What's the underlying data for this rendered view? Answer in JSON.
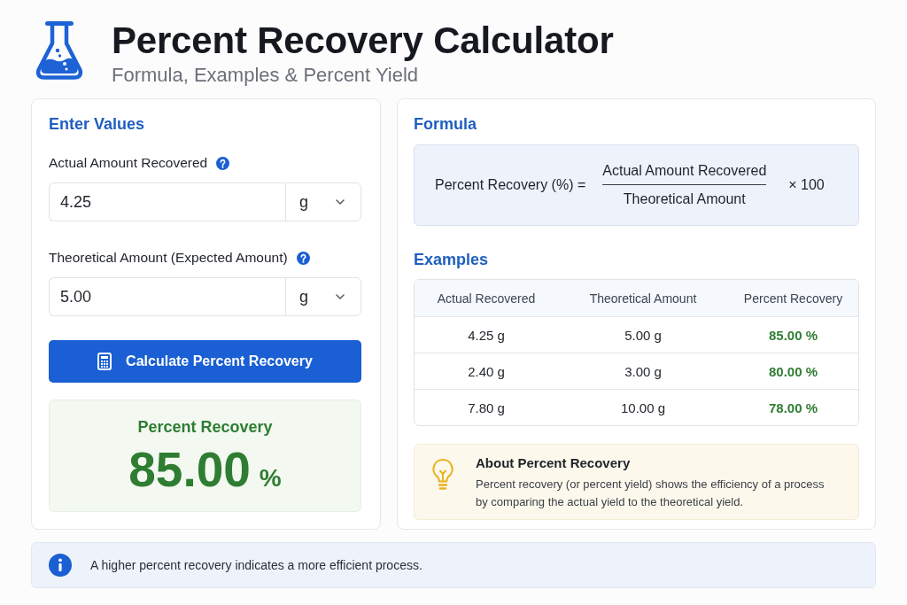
{
  "header": {
    "title": "Percent Recovery Calculator",
    "subtitle": "Formula, Examples & Percent Yield"
  },
  "input_panel": {
    "heading": "Enter Values",
    "fields": [
      {
        "label": "Actual Amount Recovered",
        "value": "4.25",
        "unit": "g"
      },
      {
        "label": "Theoretical Amount (Expected Amount)",
        "value": "5.00",
        "unit": "g"
      }
    ],
    "button": "Calculate Percent Recovery",
    "result": {
      "label": "Percent Recovery",
      "value": "85.00",
      "unit": "%"
    }
  },
  "formula_panel": {
    "heading": "Formula",
    "formula": {
      "lhs": "Percent Recovery (%) =",
      "numerator": "Actual Amount Recovered",
      "denominator": "Theoretical Amount",
      "multiplier": "× 100"
    },
    "examples": {
      "heading": "Examples",
      "columns": [
        "Actual Recovered",
        "Theoretical Amount",
        "Percent Recovery"
      ],
      "rows": [
        [
          "4.25 g",
          "5.00 g",
          "85.00 %"
        ],
        [
          "2.40 g",
          "3.00 g",
          "80.00 %"
        ],
        [
          "7.80 g",
          "10.00 g",
          "78.00 %"
        ]
      ]
    },
    "tip": {
      "title": "About Percent Recovery",
      "text": "Percent recovery (or percent yield) shows the efficiency of a process by comparing the actual yield to the theoretical yield."
    }
  },
  "info_bar": {
    "text": "A higher percent recovery indicates a more efficient process."
  }
}
